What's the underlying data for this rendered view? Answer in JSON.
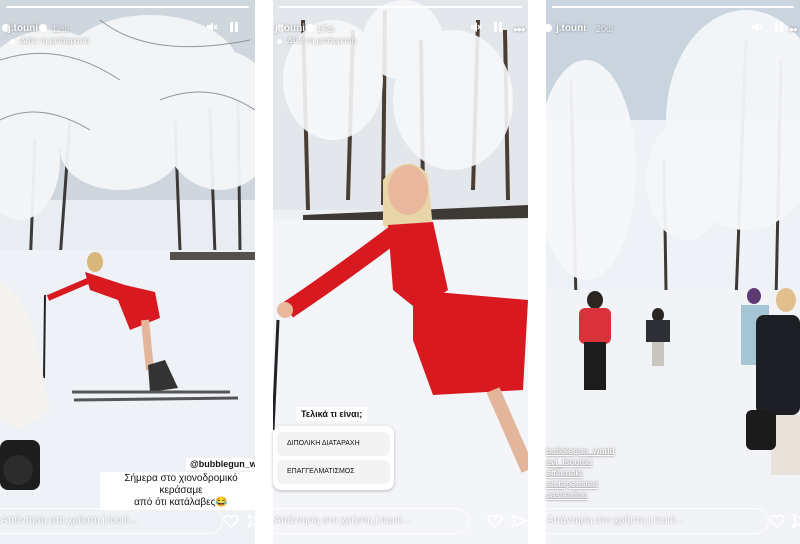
{
  "stories": [
    {
      "username": "j.touni",
      "time": "12ώ",
      "translate_label": "Δείτε τη μετάφραση",
      "mention": "@bubblegun_wo",
      "caption_lines": [
        "Σήμερα στο χιονοδρομικό κεράσαμε",
        "από ότι κατάλαβες😂"
      ],
      "reply_placeholder": "Απάντηση στο χρήστη j.touni..."
    },
    {
      "username": "j.touni",
      "time": "17ώ",
      "translate_label": "Δείτε τη μετάφραση",
      "poll": {
        "question": "Τελικά τι είναι;",
        "options": [
          "ΔΙΠΟΛΙΚΗ ΔΙΑΤΑΡΑΧΗ",
          "ΕΠΑΓΓΕΛΜΑΤΙΣΜΟΣ"
        ]
      },
      "reply_placeholder": "Απάντηση στο χρήστη j.touni..."
    },
    {
      "username": "j.touni",
      "time": "20ώ",
      "tags": [
        "bubblegun_world",
        "evi_tsoutou",
        "effihmakr",
        "arctaperisteri",
        "caslandou"
      ],
      "reply_placeholder": "Απάντηση στο χρήστη j.touni..."
    }
  ],
  "icons": {
    "mute": "mute-icon",
    "pause": "pause-icon",
    "more": "more-icon",
    "like": "heart-icon",
    "send": "send-icon"
  },
  "colors": {
    "dress_red": "#d8191f",
    "snow": "#f2f4f7"
  }
}
